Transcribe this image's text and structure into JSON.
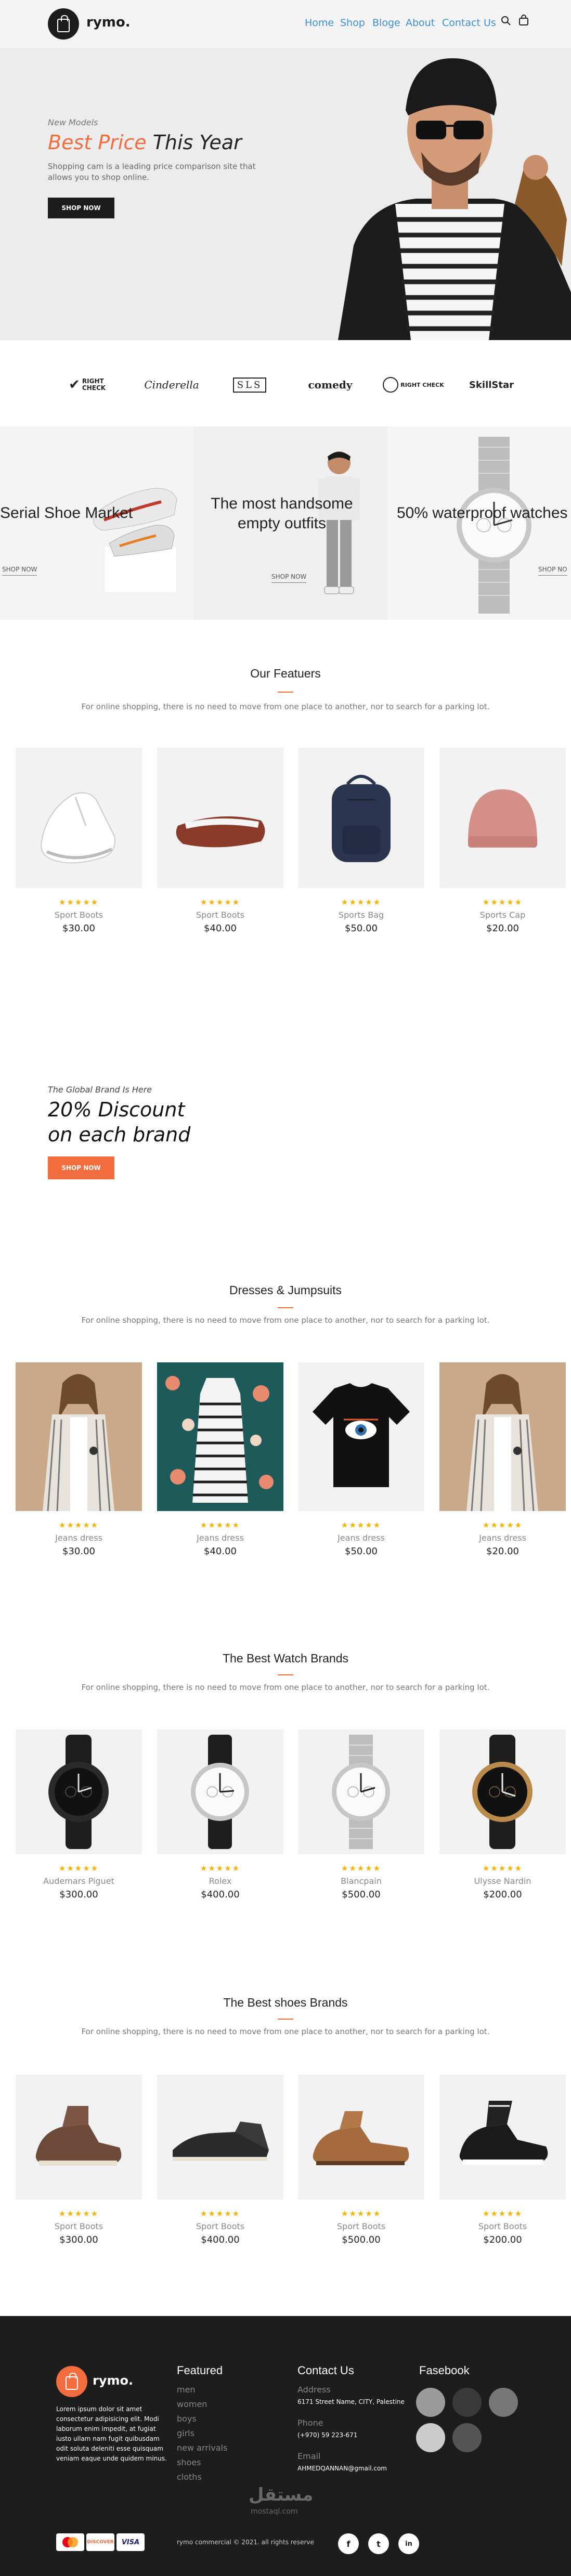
{
  "header": {
    "brand": "rymo.",
    "nav": [
      "Home",
      "Shop",
      "Bloge",
      "About",
      "Contact Us"
    ]
  },
  "hero": {
    "kicker": "New Models",
    "title_accent": "Best Price",
    "title_rest": "This Year",
    "desc": "Shopping cam is a leading price comparison site that allows you to shop online.",
    "cta": "SHOP NOW"
  },
  "brands": [
    "RIGHT CHECK",
    "Cinderella",
    "SLS",
    "comedy",
    "RIGHT CHECK",
    "SkillStar"
  ],
  "promos": [
    {
      "title": "Serial Shoe Market",
      "link": "SHOP NOW"
    },
    {
      "title": "The most handsome empty outfits",
      "link": "SHOP NOW"
    },
    {
      "title": "50% waterproof watches",
      "link": "SHOP NO"
    }
  ],
  "section_subtitle": "For online shopping, there is no need to move from one place to another, nor to search for a parking lot.",
  "features": {
    "title": "Our Featuers",
    "items": [
      {
        "name": "Sport Boots",
        "price": "$30.00"
      },
      {
        "name": "Sport Boots",
        "price": "$40.00"
      },
      {
        "name": "Sports Bag",
        "price": "$50.00"
      },
      {
        "name": "Sports Cap",
        "price": "$20.00"
      }
    ]
  },
  "discount": {
    "kicker": "The Global Brand Is Here",
    "line1": "20% Discount",
    "line2": "on each brand",
    "cta": "SHOP NOW"
  },
  "dresses": {
    "title": "Dresses & Jumpsuits",
    "items": [
      {
        "name": "Jeans dress",
        "price": "$30.00"
      },
      {
        "name": "Jeans dress",
        "price": "$40.00"
      },
      {
        "name": "Jeans dress",
        "price": "$50.00"
      },
      {
        "name": "Jeans dress",
        "price": "$20.00"
      }
    ]
  },
  "watches": {
    "title": "The Best Watch Brands",
    "items": [
      {
        "name": "Audemars Piguet",
        "price": "$300.00"
      },
      {
        "name": "Rolex",
        "price": "$400.00"
      },
      {
        "name": "Blancpain",
        "price": "$500.00"
      },
      {
        "name": "Ulysse Nardin",
        "price": "$200.00"
      }
    ]
  },
  "shoes": {
    "title": "The Best shoes Brands",
    "items": [
      {
        "name": "Sport Boots",
        "price": "$300.00"
      },
      {
        "name": "Sport Boots",
        "price": "$400.00"
      },
      {
        "name": "Sport Boots",
        "price": "$500.00"
      },
      {
        "name": "Sport Boots",
        "price": "$200.00"
      }
    ]
  },
  "stars": "★★★★★",
  "footer": {
    "brand": "rymo.",
    "about": "Lorem ipsum dolor sit amet consectetur adipisicing elit. Modi laborum enim impedit, at fugiat iusto ullam nam fugit quibusdam odit soluta deleniti esse quisquam veniam eaque unde quidem minus.",
    "featured_title": "Featured",
    "featured": [
      "men",
      "women",
      "boys",
      "girls",
      "new arrivals",
      "shoes",
      "cloths"
    ],
    "contact_title": "Contact Us",
    "address_label": "Address",
    "address": "6171 Street Name, CITY, Palestine",
    "phone_label": "Phone",
    "phone": "(+970) 59 223-671",
    "email_label": "Email",
    "email": "AHMEDQANNAN@gmail.com",
    "facebook_title": "Fasebook",
    "copyright": "rymo commercial © 2021. all rights reserve",
    "payments": [
      "mastercard",
      "DISCOVER",
      "VISA"
    ],
    "social": [
      "f",
      "t",
      "in"
    ],
    "watermark": "مستقل",
    "watermark_sub": "mostaql.com"
  },
  "colors": {
    "accent": "#f26c3e",
    "nav": "#3a8fd8",
    "star": "#f5b300",
    "footer": "#1d1d1d"
  }
}
